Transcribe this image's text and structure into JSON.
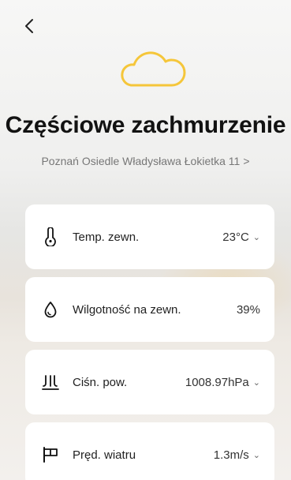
{
  "header": {
    "back_icon": "chevron-left-icon"
  },
  "weather": {
    "icon": "cloud-icon",
    "accent_color": "#F5C63A",
    "condition": "Częściowe zachmurzenie",
    "location": "Poznań Osiedle Władysława Łokietka 11",
    "location_arrow": ">"
  },
  "cards": [
    {
      "icon": "thermometer-icon",
      "label": "Temp. zewn.",
      "value": "23°C",
      "has_dropdown": true
    },
    {
      "icon": "droplet-icon",
      "label": "Wilgotność na zewn.",
      "value": "39%",
      "has_dropdown": false
    },
    {
      "icon": "pressure-icon",
      "label": "Ciśn. pow.",
      "value": "1008.97hPa",
      "has_dropdown": true
    },
    {
      "icon": "wind-flag-icon",
      "label": "Pręd. wiatru",
      "value": "1.3m/s",
      "has_dropdown": true
    }
  ],
  "dropdown_glyph": "⌄"
}
